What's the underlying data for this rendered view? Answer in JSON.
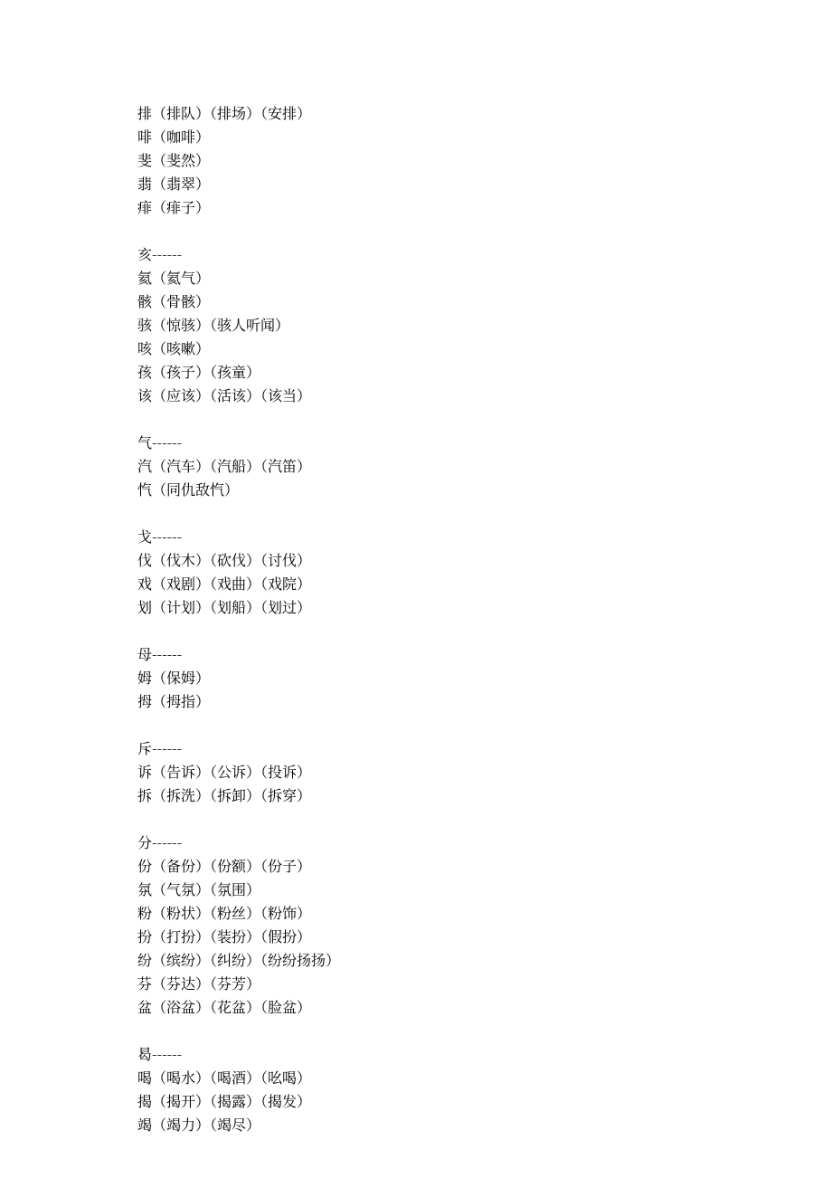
{
  "groups": [
    {
      "header": null,
      "lines": [
        "排（排队）（排场）（安排）",
        "啡（咖啡）",
        "斐（斐然）",
        "翡（翡翠）",
        "痱（痱子）"
      ]
    },
    {
      "header": "亥------",
      "lines": [
        "氦（氦气）",
        "骸（骨骸）",
        "骇（惊骇）（骇人听闻）",
        "咳（咳嗽）",
        "孩（孩子）（孩童）",
        "该（应该）（活该）（该当）"
      ]
    },
    {
      "header": "气------",
      "lines": [
        "汽（汽车）（汽船）（汽笛）",
        "忾（同仇敌忾）"
      ]
    },
    {
      "header": "戈------",
      "lines": [
        "伐（伐木）（砍伐）（讨伐）",
        "戏（戏剧）（戏曲）（戏院）",
        "划（计划）（划船）（划过）"
      ]
    },
    {
      "header": "母------",
      "lines": [
        "姆（保姆）",
        "拇（拇指）"
      ]
    },
    {
      "header": "斥------",
      "lines": [
        "诉（告诉）（公诉）（投诉）",
        "拆（拆洗）（拆卸）（拆穿）"
      ]
    },
    {
      "header": "分------",
      "lines": [
        "份（备份）（份额）（份子）",
        "氛（气氛）（氛围）",
        "粉（粉状）（粉丝）（粉饰）",
        "扮（打扮）（装扮）（假扮）",
        "纷（缤纷）（纠纷）（纷纷扬扬）",
        "芬（芬达）（芬芳）",
        "盆（浴盆）（花盆）（脸盆）"
      ]
    },
    {
      "header": "曷------",
      "lines": [
        "喝（喝水）（喝酒）（吆喝）",
        "揭（揭开）（揭露）（揭发）",
        "竭（竭力）（竭尽）"
      ]
    }
  ]
}
